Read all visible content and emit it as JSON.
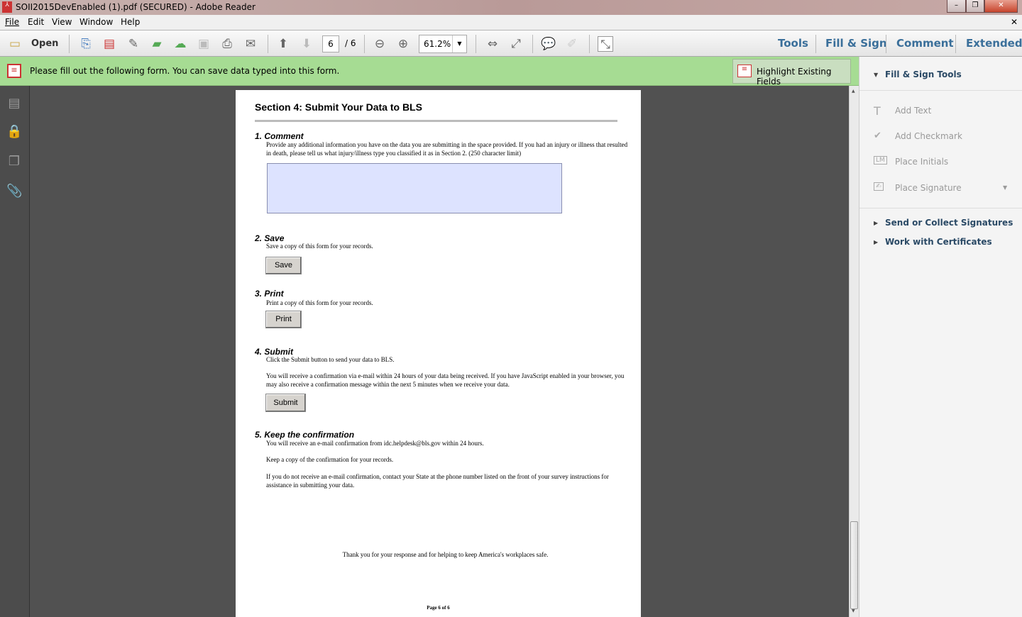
{
  "window": {
    "title": "SOII2015DevEnabled (1).pdf (SECURED) - Adobe Reader",
    "minimize": "–",
    "restore": "❐",
    "close": "✕",
    "doc_close": "✕"
  },
  "menu": [
    "File",
    "Edit",
    "View",
    "Window",
    "Help"
  ],
  "toolbar": {
    "open_label": "Open",
    "page_current": "6",
    "page_total": "/ 6",
    "zoom": "61.2%",
    "tools": "Tools",
    "fill_sign": "Fill & Sign",
    "comment": "Comment",
    "extended": "Extended"
  },
  "notice": {
    "text": "Please fill out the following form. You can save data typed into this form.",
    "highlight_button": "Highlight Existing Fields"
  },
  "right_panel": {
    "header": "Fill & Sign Tools",
    "tools": [
      "Add Text",
      "Add Checkmark",
      "Place Initials",
      "Place Signature"
    ],
    "sections": [
      "Send or Collect Signatures",
      "Work with Certificates"
    ]
  },
  "page": {
    "title": "Section 4: Submit Your Data to BLS",
    "s1_title": "1.  Comment",
    "s1_text": "Provide any additional information you have on the data you are submitting in the space provided.  If you had an injury or illness that resulted in death, please tell us what injury/illness type you classified it as in Section 2. (250 character limit)",
    "s1_value": "",
    "s2_title": "2.  Save",
    "s2_text": "Save a copy of this form for your records.",
    "s2_button": "Save",
    "s3_title": "3.  Print",
    "s3_text": "Print a copy of this form for your records.",
    "s3_button": "Print",
    "s4_title": "4.  Submit",
    "s4_text1": "Click the Submit button to send your data to BLS.",
    "s4_text2": "You will receive a confirmation via e-mail within 24 hours of your data being received.  If you have JavaScript enabled in your browser, you may also receive a confirmation message within the next 5 minutes when we receive your data.",
    "s4_button": "Submit",
    "s5_title": "5.  Keep the confirmation",
    "s5_text1": "You will receive an e-mail confirmation from idc.helpdesk@bls.gov within 24 hours.",
    "s5_text2": "Keep a copy of the confirmation for your records.",
    "s5_text3": "If you do not receive an e-mail confirmation, contact your State at the phone number listed on the front of your survey instructions for assistance in submitting your data.",
    "thanks": "Thank you for your response and for helping to keep America's workplaces safe.",
    "footer": "Page 6 of 6"
  }
}
